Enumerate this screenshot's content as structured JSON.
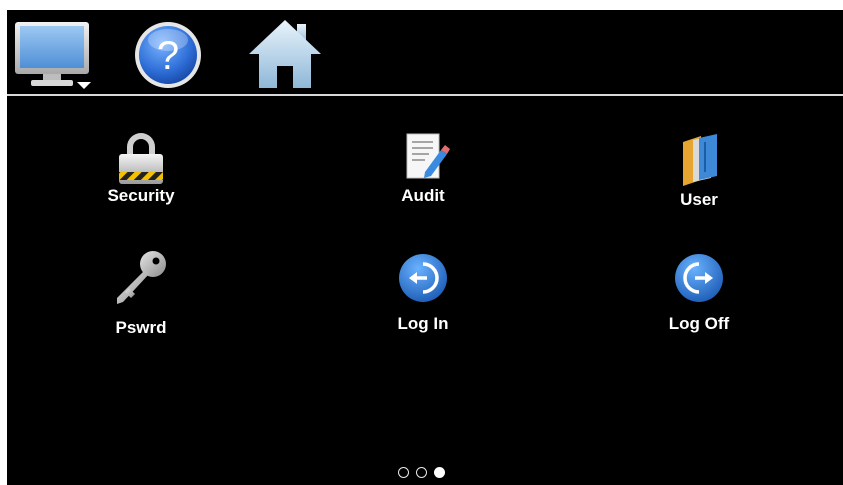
{
  "toolbar": {
    "display_button": "monitor-icon",
    "help_button": "help-icon",
    "help_glyph": "?",
    "home_button": "home-icon"
  },
  "tiles": [
    {
      "label": "Security",
      "icon": "padlock-icon"
    },
    {
      "label": "Audit",
      "icon": "document-pencil-icon"
    },
    {
      "label": "User",
      "icon": "folders-icon"
    },
    {
      "label": "Pswrd",
      "icon": "key-icon"
    },
    {
      "label": "Log In",
      "icon": "login-arrow-icon"
    },
    {
      "label": "Log Off",
      "icon": "logoff-arrow-icon"
    }
  ],
  "pager": {
    "pages": 3,
    "current_page": 3
  },
  "colors": {
    "background": "#000000",
    "label": "#ffffff",
    "divider": "#d8d8d8",
    "help_blue": "#2f6fd8",
    "arrow_blue": "#1e74d6",
    "home_blue": "#bcd7ea"
  }
}
